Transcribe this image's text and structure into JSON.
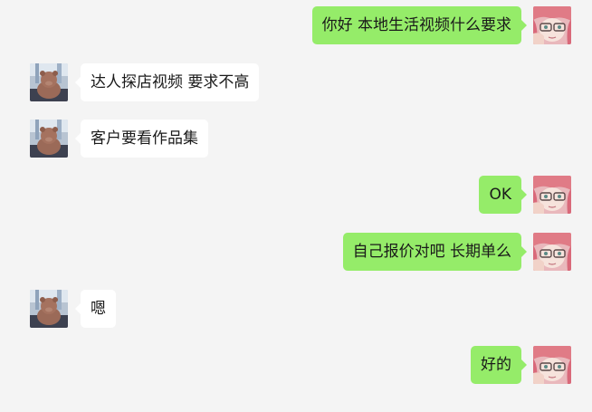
{
  "colors": {
    "background": "#f4f4f4",
    "incoming_bubble": "#ffffff",
    "outgoing_bubble": "#95ec69",
    "text": "#1a1a1a"
  },
  "messages": [
    {
      "direction": "out",
      "text": "你好 本地生活视频什么要求"
    },
    {
      "direction": "in",
      "text": "达人探店视频 要求不高"
    },
    {
      "direction": "in",
      "text": "客户要看作品集"
    },
    {
      "direction": "out",
      "text": "OK"
    },
    {
      "direction": "out",
      "text": "自己报价对吧 长期单么"
    },
    {
      "direction": "in",
      "text": "嗯"
    },
    {
      "direction": "out",
      "text": "好的"
    }
  ]
}
